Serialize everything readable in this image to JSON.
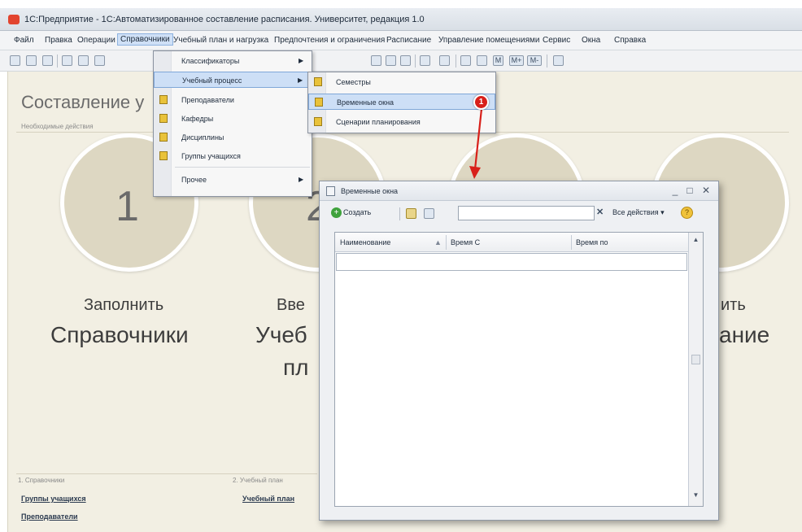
{
  "window": {
    "title": "1С:Предприятие - 1С:Автоматизированное составление расписания. Университет, редакция 1.0"
  },
  "menubar": {
    "items": [
      "Файл",
      "Правка",
      "Операции",
      "Справочники",
      "Учебный план и нагрузка",
      "Предпочтения и ограничения",
      "Расписание",
      "Управление помещениями",
      "Сервис",
      "Окна",
      "Справка"
    ],
    "active": "Справочники"
  },
  "toolbar": {
    "icons": [
      "new-document-icon",
      "open-folder-icon",
      "save-icon",
      "cut-icon",
      "copy-icon",
      "paste-icon",
      "undo-icon",
      "redo-icon",
      "find-icon",
      "help-icon",
      "calculator-icon",
      "calendar-icon",
      "m-icon",
      "m-plus-icon",
      "m-minus-icon",
      "tips-icon"
    ],
    "labels": {
      "m": "M",
      "m_plus": "M+",
      "m_minus": "M-"
    }
  },
  "page": {
    "heading": "Составление у",
    "needed_actions": "Необходимые действия",
    "step1_number": "1",
    "step2_number": "2",
    "step1_line1": "Заполнить",
    "step1_line2": "Справочники",
    "step2_line1": "Вве",
    "step2_line2": "Учеб",
    "step2_line3": "пл",
    "step4_line1": "ить",
    "step4_line2": "ание"
  },
  "bottom": {
    "section1": "1. Справочники",
    "section2": "2. Учебный план",
    "link1": "Группы учащихся",
    "link2": "Преподаватели",
    "link3": "Учебный план"
  },
  "directory_menu": {
    "items": [
      {
        "label": "Классификаторы",
        "submenu": true
      },
      {
        "label": "Учебный процесс",
        "submenu": true
      },
      {
        "label": "Преподаватели",
        "submenu": false
      },
      {
        "label": "Кафедры",
        "submenu": false
      },
      {
        "label": "Дисциплины",
        "submenu": false
      },
      {
        "label": "Группы учащихся",
        "submenu": false
      },
      {
        "label": "Прочее",
        "submenu": true
      }
    ]
  },
  "process_submenu": {
    "items": [
      "Семестры",
      "Временные окна",
      "Сценарии планирования"
    ],
    "highlighted": "Временные окна"
  },
  "callout": {
    "number": "1"
  },
  "dialog": {
    "title": "Временные окна",
    "create_label": "Создать",
    "search_value": "",
    "all_actions": "Все действия",
    "columns": [
      "Наименование",
      "Время С",
      "Время по"
    ],
    "rows": []
  },
  "colors": {
    "accent": "#d8201a",
    "highlight": "#cddff6",
    "desktop": "#f2efe3"
  }
}
